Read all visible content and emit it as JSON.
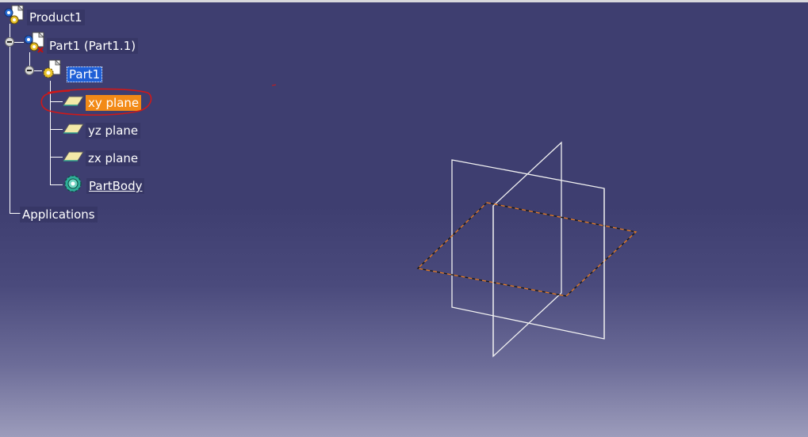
{
  "tree": {
    "root": {
      "label": "Product1",
      "icon": "product-icon"
    },
    "part_instance": {
      "label": "Part1 (Part1.1)",
      "icon": "part-instance-icon"
    },
    "part": {
      "label": "Part1",
      "icon": "part-icon",
      "state": "selected"
    },
    "planes": [
      {
        "label": "xy plane",
        "icon": "plane-icon",
        "state": "highlighted"
      },
      {
        "label": "yz plane",
        "icon": "plane-icon"
      },
      {
        "label": "zx plane",
        "icon": "plane-icon"
      }
    ],
    "body": {
      "label": "PartBody",
      "icon": "partbody-gear-icon"
    },
    "applications": {
      "label": "Applications"
    }
  },
  "colors": {
    "background_top": "#3e3e70",
    "background_bottom": "#9c9cbb",
    "selection_blue": "#1f5fd6",
    "highlight_orange": "#f28a17",
    "annotation_red": "#d01818",
    "plane_edge": "#f2f2f2",
    "plane_dash": "#e07a2a"
  }
}
